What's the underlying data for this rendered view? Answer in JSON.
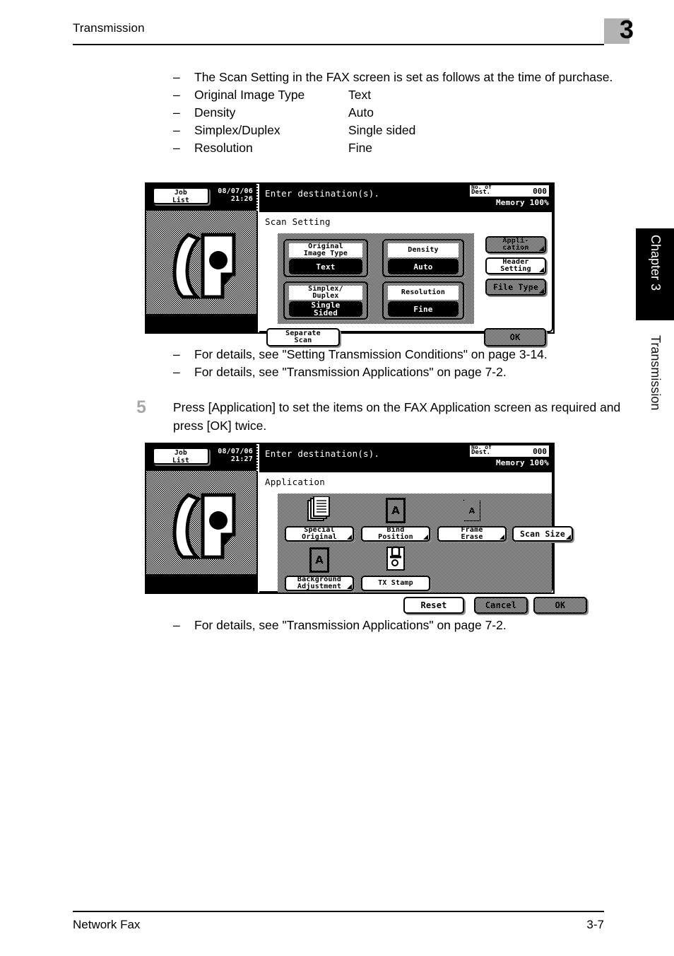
{
  "header": {
    "running_title": "Transmission",
    "chapter_number": "3"
  },
  "side_tabs": {
    "chapter_tab": "Chapter 3",
    "section_label": "Transmission"
  },
  "footer": {
    "left": "Network Fax",
    "right": "3-7"
  },
  "intro_list": [
    {
      "dash": "–",
      "text": "The Scan Setting in the FAX screen is set as follows at the time of purchase.",
      "value": ""
    },
    {
      "dash": "–",
      "text": "Original Image Type",
      "value": "Text"
    },
    {
      "dash": "–",
      "text": "Density",
      "value": "Auto"
    },
    {
      "dash": "–",
      "text": "Simplex/Duplex",
      "value": "Single sided"
    },
    {
      "dash": "–",
      "text": "Resolution",
      "value": "Fine"
    }
  ],
  "refs_1": [
    {
      "dash": "–",
      "text": "For details, see \"Setting Transmission Conditions\" on page 3-14."
    },
    {
      "dash": "–",
      "text": "For details, see \"Transmission Applications\" on page 7-2."
    }
  ],
  "step5": {
    "number": "5",
    "text": "Press [Application] to set the items on the FAX Application screen as required and press [OK] twice."
  },
  "refs_2": [
    {
      "dash": "–",
      "text": "For details, see \"Transmission Applications\" on page 7-2."
    }
  ],
  "lcd_scan_setting": {
    "job_list_line1": "Job",
    "job_list_line2": "List",
    "date": "08/07/06",
    "time": "21:26",
    "message": "Enter destination(s).",
    "dest_label_line1": "No. of",
    "dest_label_line2": "Dest.",
    "dest_value": "000",
    "memory": "Memory 100%",
    "screen_title": "Scan Setting",
    "cards": [
      {
        "label_line1": "Original",
        "label_line2": "Image Type",
        "value_line1": "Text",
        "value_line2": ""
      },
      {
        "label_line1": "Density",
        "label_line2": "",
        "value_line1": "Auto",
        "value_line2": ""
      },
      {
        "label_line1": "Simplex/",
        "label_line2": "Duplex",
        "value_line1": "Single",
        "value_line2": "Sided"
      },
      {
        "label_line1": "Resolution",
        "label_line2": "",
        "value_line1": "Fine",
        "value_line2": ""
      }
    ],
    "side_buttons": [
      {
        "line1": "Appli-",
        "line2": "cation"
      },
      {
        "line1": "Header",
        "line2": "Setting"
      },
      {
        "line1": "File Type",
        "line2": ""
      }
    ],
    "separate_scan_line1": "Separate",
    "separate_scan_line2": "Scan",
    "ok_label": "OK"
  },
  "lcd_application": {
    "job_list_line1": "Job",
    "job_list_line2": "List",
    "date": "08/07/06",
    "time": "21:27",
    "message": "Enter destination(s).",
    "dest_label_line1": "No. of",
    "dest_label_line2": "Dest.",
    "dest_value": "000",
    "memory": "Memory 100%",
    "screen_title": "Application",
    "tiles_row1": [
      {
        "icon": "stacked-pages-icon",
        "line1": "Special",
        "line2": "Original"
      },
      {
        "icon": "bind-position-icon",
        "line1": "Bind",
        "line2": "Position"
      },
      {
        "icon": "frame-erase-icon",
        "line1": "Frame",
        "line2": "Erase"
      }
    ],
    "scan_size": {
      "line1": "Scan Size",
      "line2": ""
    },
    "tiles_row2": [
      {
        "icon": "background-letter-a-icon",
        "line1": "Background",
        "line2": "Adjustment"
      },
      {
        "icon": "stamp-icon",
        "line1": "TX Stamp",
        "line2": ""
      }
    ],
    "reset_label": "Reset",
    "cancel_label": "Cancel",
    "ok_label": "OK"
  }
}
